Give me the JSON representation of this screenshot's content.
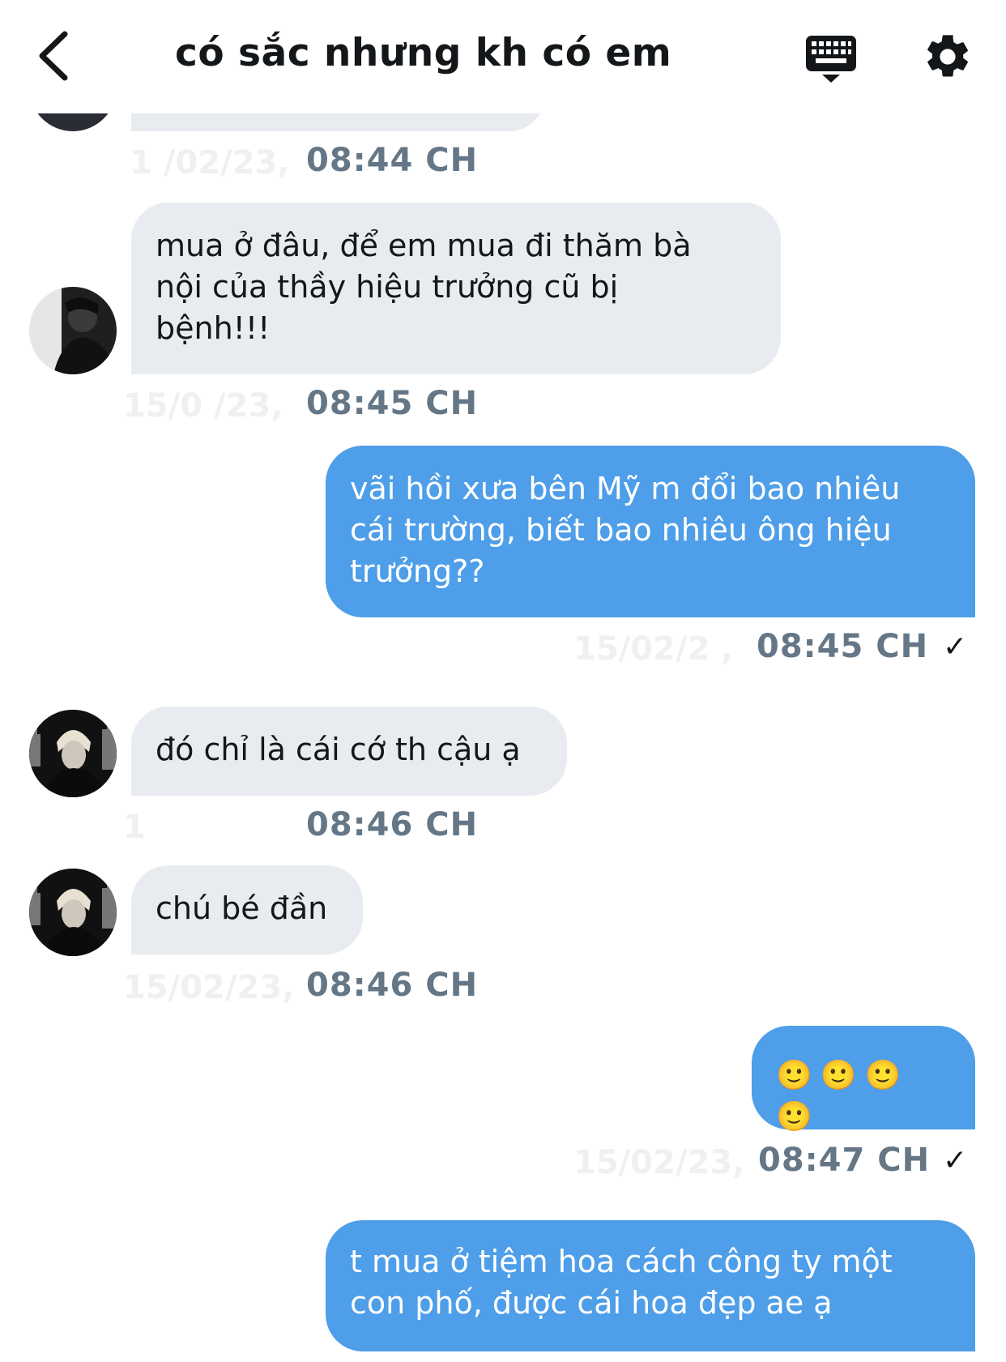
{
  "header": {
    "title": "có sắc nhưng kh có em",
    "back_icon": "chevron-left-icon",
    "keyboard_icon": "keyboard-icon",
    "settings_icon": "gear-icon"
  },
  "messages": [
    {
      "id": "m0",
      "time": "08:44 CH",
      "date_ghost": "1 /02/23,"
    },
    {
      "id": "m1",
      "side": "received",
      "lines": [
        "mua ở đâu, để em mua đi thăm bà",
        "nội của thầy hiệu trưởng cũ bị",
        "bệnh!!!"
      ],
      "time": "08:45 CH",
      "date_ghost": "15/0 /23,"
    },
    {
      "id": "m2",
      "side": "sent",
      "lines": [
        "vãi hồi xưa bên Mỹ m đổi bao nhiêu",
        "cái trường, biết bao nhiêu ông hiệu",
        "trưởng??"
      ],
      "time": "08:45 CH",
      "date_ghost": "15/02/2 ,",
      "status": "✓"
    },
    {
      "id": "m3",
      "side": "received",
      "lines": [
        "đó chỉ là cái cớ th cậu ạ"
      ],
      "time": "08:46 CH",
      "date_ghost": "1"
    },
    {
      "id": "m4",
      "side": "received",
      "lines": [
        "chú bé đần"
      ],
      "time": "08:46 CH",
      "date_ghost": "15/02/23,"
    },
    {
      "id": "m5",
      "side": "sent",
      "lines": [
        "🙂🙂🙂🙂"
      ],
      "time": "08:47 CH",
      "date_ghost": "15/02/23,",
      "status": "✓"
    },
    {
      "id": "m6",
      "side": "sent",
      "lines": [
        "t mua ở tiệm hoa cách công ty một",
        "con phố, được cái hoa đẹp ae ạ"
      ]
    }
  ],
  "colors": {
    "sent_bubble": "#4e9ee9",
    "received_bubble": "#e8ebef",
    "timestamp": "#657786"
  }
}
